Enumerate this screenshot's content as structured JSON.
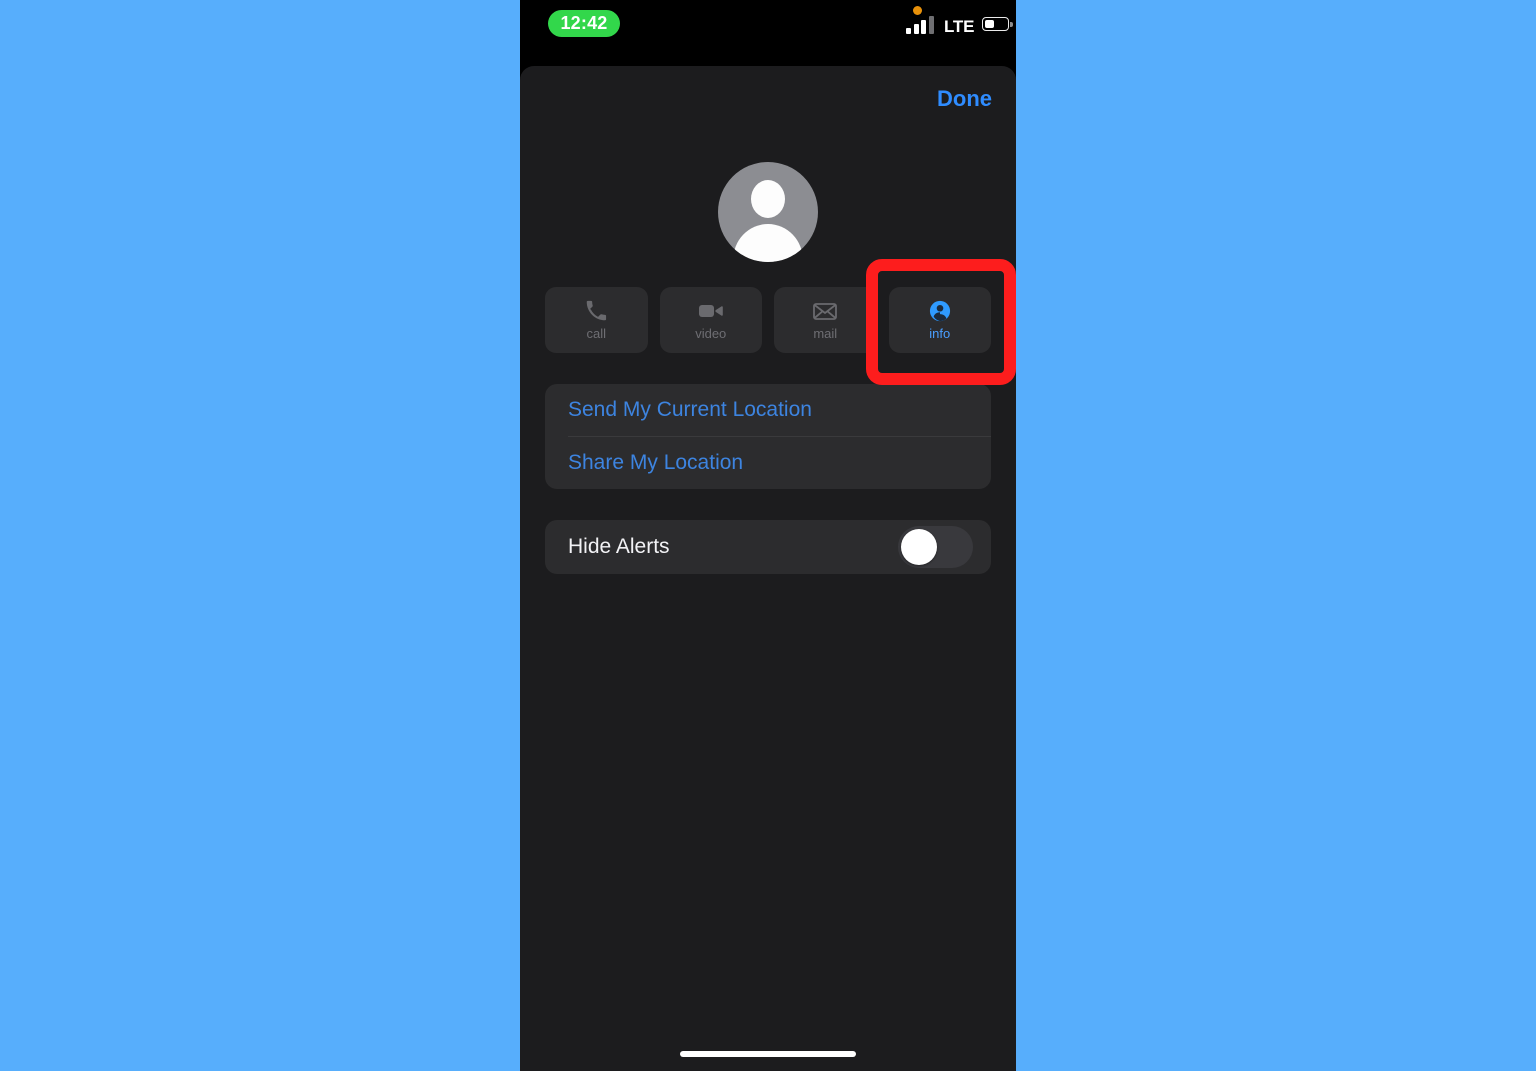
{
  "background_color": "#57aefc",
  "status_bar": {
    "time": "12:42",
    "time_pill_color": "#32d74b",
    "privacy_dot": "orange-privacy-dot",
    "signal_icon": "cellular-signal-icon",
    "carrier": "LTE",
    "battery_icon": "battery-icon",
    "battery_level_percent": 40
  },
  "sheet": {
    "done_label": "Done",
    "done_color": "#2f8cff",
    "avatar": "default-contact-avatar"
  },
  "actions": [
    {
      "id": "call",
      "label": "call",
      "icon": "phone-icon",
      "enabled": false
    },
    {
      "id": "video",
      "label": "video",
      "icon": "video-camera-icon",
      "enabled": false
    },
    {
      "id": "mail",
      "label": "mail",
      "icon": "envelope-icon",
      "enabled": false
    },
    {
      "id": "info",
      "label": "info",
      "icon": "contact-info-icon",
      "enabled": true
    }
  ],
  "location_card": {
    "rows": [
      {
        "label": "Send My Current Location"
      },
      {
        "label": "Share My Location"
      }
    ]
  },
  "hide_alerts": {
    "label": "Hide Alerts",
    "enabled": false,
    "state_text": "off"
  },
  "annotation": {
    "target": "info",
    "shape": "rounded-rectangle",
    "color": "#fd1d1d"
  }
}
